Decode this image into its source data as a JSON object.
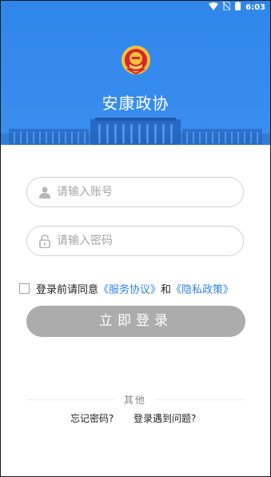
{
  "status_bar": {
    "time": "6:03"
  },
  "app": {
    "title": "安康政协"
  },
  "form": {
    "account_placeholder": "请输入账号",
    "password_placeholder": "请输入密码",
    "agreement": {
      "prefix": "登录前请同意",
      "service_link": "《服务协议》",
      "conjunction": "和",
      "privacy_link": "《隐私政策》",
      "checked": false
    },
    "login_button": "立即登录"
  },
  "footer": {
    "other_label": "其他",
    "forgot_password": "忘记密码?",
    "login_problem": "登录遇到问题?"
  },
  "colors": {
    "header_blue": "#3a8ff0",
    "link_blue": "#2f86ea",
    "button_gray": "#acacac"
  }
}
